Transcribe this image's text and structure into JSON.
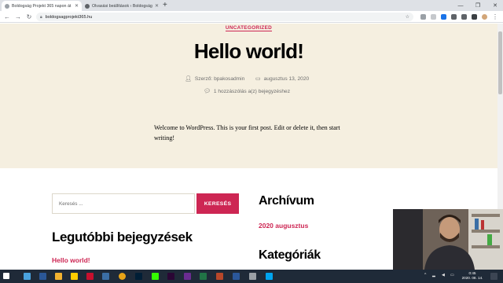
{
  "browser": {
    "tabs": [
      {
        "title": "Boldogság Projekt 365 napon át",
        "active": true
      },
      {
        "title": "Olvasási beállítások ‹ Boldogság",
        "active": false
      }
    ],
    "new_tab_label": "+",
    "url": "boldogsagprojekt365.hu"
  },
  "post": {
    "category": "UNCATEGORIZED",
    "title": "Hello world!",
    "author": "Szerző: bpakosadmin",
    "date": "augusztus 13, 2020",
    "comments": "1 hozzászólás a(z) bejegyzéshez",
    "body": "Welcome to WordPress. This is your first post. Edit or delete it, then start writing!"
  },
  "search": {
    "placeholder": "Keresés ...",
    "button_label": "KERESÉS"
  },
  "widgets": {
    "recent_posts_title": "Legutóbbi bejegyzések",
    "recent_post_item": "Hello world!",
    "archive_title": "Archívum",
    "archive_item": "2020 augusztus",
    "categories_title": "Kategóriák"
  },
  "taskbar": {
    "time": "0:45",
    "date": "2020. 08. 14."
  },
  "colors": {
    "accent": "#cd2653",
    "hero_bg": "#f5efe0",
    "taskbar_bg": "#1f2a38"
  }
}
